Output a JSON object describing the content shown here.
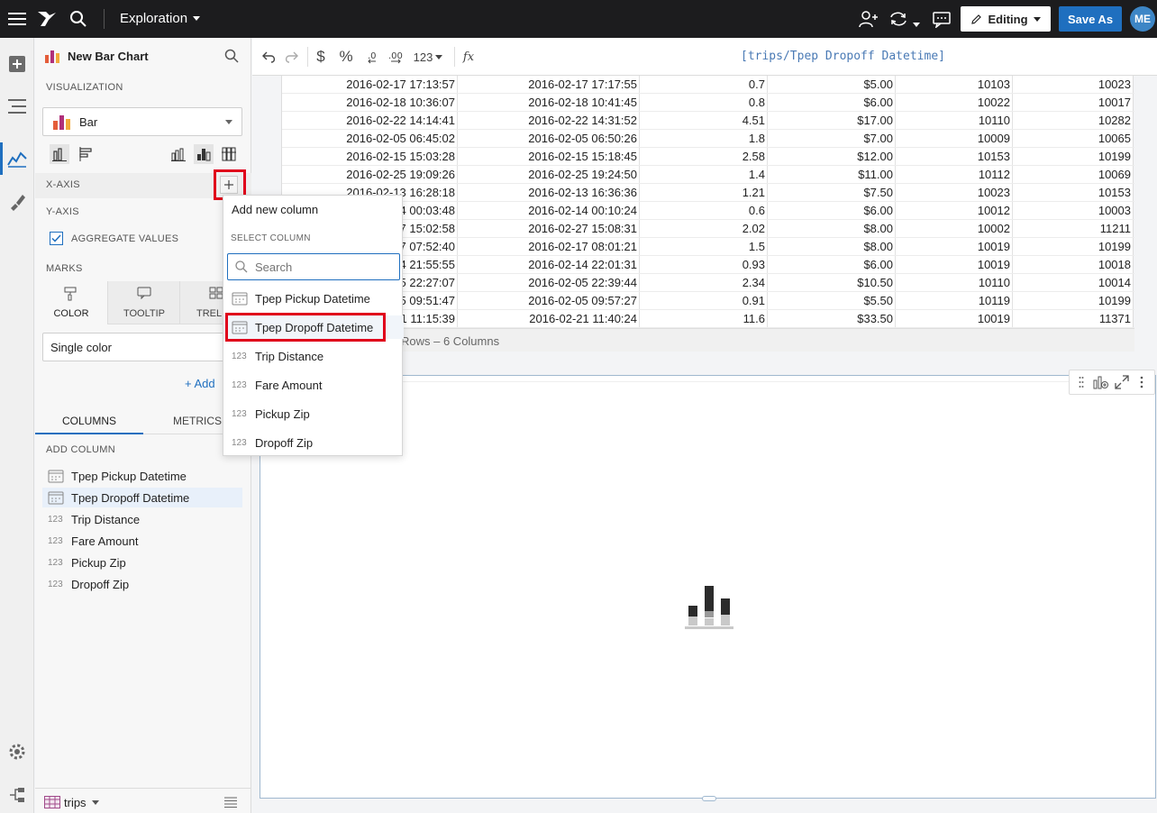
{
  "topbar": {
    "title": "Exploration",
    "editing_label": "Editing",
    "save_as_label": "Save As",
    "avatar_initials": "ME",
    "icons": [
      "hamburger-menu-icon",
      "logo-icon",
      "search-icon",
      "add-user-icon",
      "sync-icon",
      "comment-icon",
      "pencil-icon"
    ]
  },
  "panel": {
    "element_name": "New Bar Chart",
    "visualization_label": "VISUALIZATION",
    "viz_type": "Bar",
    "x_axis_label": "X-AXIS",
    "y_axis_label": "Y-AXIS",
    "aggregate_label": "AGGREGATE VALUES",
    "aggregate_checked": true,
    "marks_label": "MARKS",
    "marks_tabs": [
      "COLOR",
      "TOOLTIP",
      "TRELLI"
    ],
    "color_mode": "Single color",
    "add_label": "+ Add",
    "bottom_tabs": [
      "COLUMNS",
      "METRICS"
    ],
    "add_column_label": "ADD COLUMN",
    "columns": [
      {
        "name": "Tpep Pickup Datetime",
        "type": "date"
      },
      {
        "name": "Tpep Dropoff Datetime",
        "type": "date",
        "selected": true
      },
      {
        "name": "Trip Distance",
        "type": "123"
      },
      {
        "name": "Fare Amount",
        "type": "123"
      },
      {
        "name": "Pickup Zip",
        "type": "123"
      },
      {
        "name": "Dropoff Zip",
        "type": "123"
      }
    ],
    "source_name": "trips"
  },
  "formula_bar": {
    "number_format": "123",
    "formula": "[trips/Tpep Dropoff Datetime]"
  },
  "table": {
    "rows": [
      [
        "2016-02-17 17:13:57",
        "2016-02-17 17:17:55",
        "0.7",
        "$5.00",
        "10103",
        "10023"
      ],
      [
        "2016-02-18 10:36:07",
        "2016-02-18 10:41:45",
        "0.8",
        "$6.00",
        "10022",
        "10017"
      ],
      [
        "2016-02-22 14:14:41",
        "2016-02-22 14:31:52",
        "4.51",
        "$17.00",
        "10110",
        "10282"
      ],
      [
        "2016-02-05 06:45:02",
        "2016-02-05 06:50:26",
        "1.8",
        "$7.00",
        "10009",
        "10065"
      ],
      [
        "2016-02-15 15:03:28",
        "2016-02-15 15:18:45",
        "2.58",
        "$12.00",
        "10153",
        "10199"
      ],
      [
        "2016-02-25 19:09:26",
        "2016-02-25 19:24:50",
        "1.4",
        "$11.00",
        "10112",
        "10069"
      ],
      [
        "2016-02-13 16:28:18",
        "2016-02-13 16:36:36",
        "1.21",
        "$7.50",
        "10023",
        "10153"
      ],
      [
        "4 00:03:48",
        "2016-02-14 00:10:24",
        "0.6",
        "$6.00",
        "10012",
        "10003"
      ],
      [
        "7 15:02:58",
        "2016-02-27 15:08:31",
        "2.02",
        "$8.00",
        "10002",
        "11211"
      ],
      [
        "7 07:52:40",
        "2016-02-17 08:01:21",
        "1.5",
        "$8.00",
        "10019",
        "10199"
      ],
      [
        "4 21:55:55",
        "2016-02-14 22:01:31",
        "0.93",
        "$6.00",
        "10019",
        "10018"
      ],
      [
        "5 22:27:07",
        "2016-02-05 22:39:44",
        "2.34",
        "$10.50",
        "10110",
        "10014"
      ],
      [
        "5 09:51:47",
        "2016-02-05 09:57:27",
        "0.91",
        "$5.50",
        "10119",
        "10199"
      ],
      [
        "1 11:15:39",
        "2016-02-21 11:40:24",
        "11.6",
        "$33.50",
        "10019",
        "11371"
      ]
    ],
    "footer": "Rows – 6 Columns"
  },
  "dropdown": {
    "add_new_label": "Add new column",
    "select_label": "SELECT COLUMN",
    "search_placeholder": "Search",
    "items": [
      {
        "name": "Tpep Pickup Datetime",
        "type": "date"
      },
      {
        "name": "Tpep Dropoff Datetime",
        "type": "date",
        "highlighted": true
      },
      {
        "name": "Trip Distance",
        "type": "123"
      },
      {
        "name": "Fare Amount",
        "type": "123"
      },
      {
        "name": "Pickup Zip",
        "type": "123"
      },
      {
        "name": "Dropoff Zip",
        "type": "123"
      }
    ]
  },
  "colors": {
    "topbar_bg": "#1c1c1e",
    "accent_blue": "#1f6fbf",
    "highlight_red": "#e0001b"
  }
}
